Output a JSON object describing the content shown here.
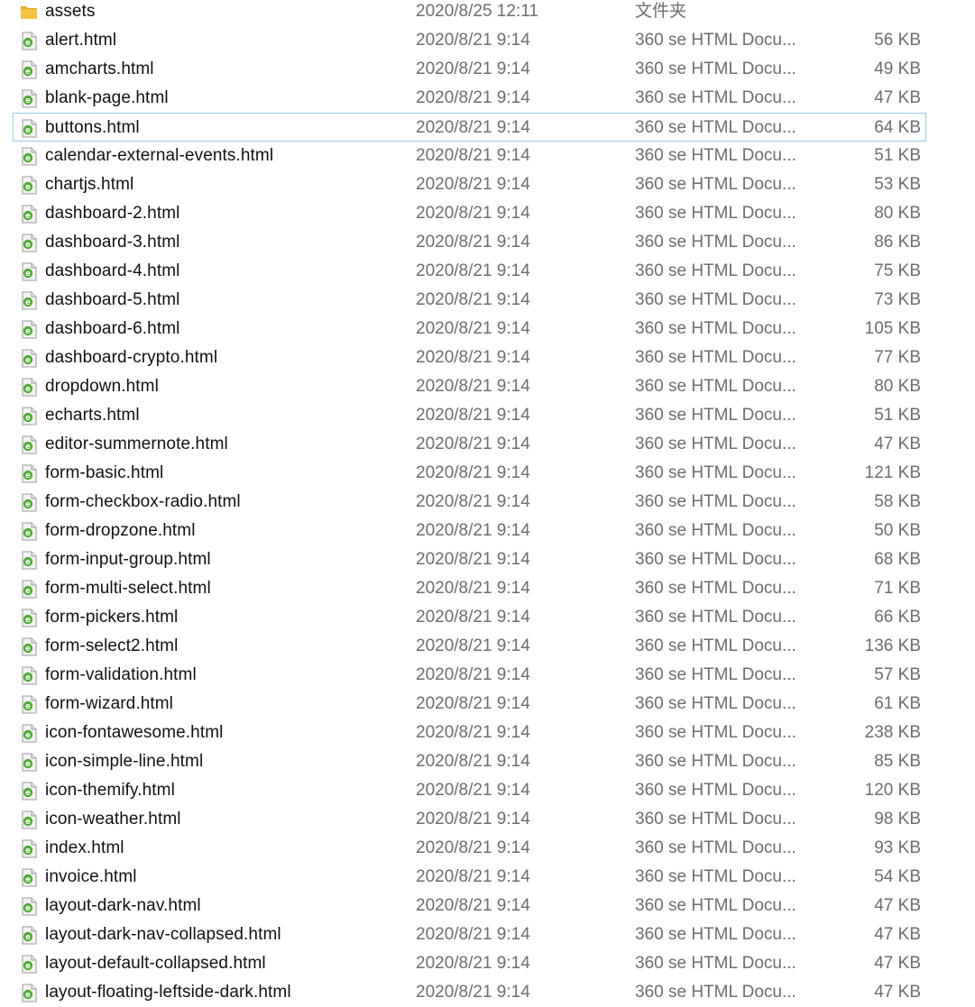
{
  "files": [
    {
      "name": "assets",
      "date": "2020/8/25 12:11",
      "type": "文件夹",
      "size": "",
      "icon": "folder-icon"
    },
    {
      "name": "alert.html",
      "date": "2020/8/21 9:14",
      "type": "360 se HTML Docu...",
      "size": "56 KB",
      "icon": "html-document-icon"
    },
    {
      "name": "amcharts.html",
      "date": "2020/8/21 9:14",
      "type": "360 se HTML Docu...",
      "size": "49 KB",
      "icon": "html-document-icon"
    },
    {
      "name": "blank-page.html",
      "date": "2020/8/21 9:14",
      "type": "360 se HTML Docu...",
      "size": "47 KB",
      "icon": "html-document-icon"
    },
    {
      "name": "buttons.html",
      "date": "2020/8/21 9:14",
      "type": "360 se HTML Docu...",
      "size": "64 KB",
      "icon": "html-document-icon",
      "selected": true
    },
    {
      "name": "calendar-external-events.html",
      "date": "2020/8/21 9:14",
      "type": "360 se HTML Docu...",
      "size": "51 KB",
      "icon": "html-document-icon"
    },
    {
      "name": "chartjs.html",
      "date": "2020/8/21 9:14",
      "type": "360 se HTML Docu...",
      "size": "53 KB",
      "icon": "html-document-icon"
    },
    {
      "name": "dashboard-2.html",
      "date": "2020/8/21 9:14",
      "type": "360 se HTML Docu...",
      "size": "80 KB",
      "icon": "html-document-icon"
    },
    {
      "name": "dashboard-3.html",
      "date": "2020/8/21 9:14",
      "type": "360 se HTML Docu...",
      "size": "86 KB",
      "icon": "html-document-icon"
    },
    {
      "name": "dashboard-4.html",
      "date": "2020/8/21 9:14",
      "type": "360 se HTML Docu...",
      "size": "75 KB",
      "icon": "html-document-icon"
    },
    {
      "name": "dashboard-5.html",
      "date": "2020/8/21 9:14",
      "type": "360 se HTML Docu...",
      "size": "73 KB",
      "icon": "html-document-icon"
    },
    {
      "name": "dashboard-6.html",
      "date": "2020/8/21 9:14",
      "type": "360 se HTML Docu...",
      "size": "105 KB",
      "icon": "html-document-icon"
    },
    {
      "name": "dashboard-crypto.html",
      "date": "2020/8/21 9:14",
      "type": "360 se HTML Docu...",
      "size": "77 KB",
      "icon": "html-document-icon"
    },
    {
      "name": "dropdown.html",
      "date": "2020/8/21 9:14",
      "type": "360 se HTML Docu...",
      "size": "80 KB",
      "icon": "html-document-icon"
    },
    {
      "name": "echarts.html",
      "date": "2020/8/21 9:14",
      "type": "360 se HTML Docu...",
      "size": "51 KB",
      "icon": "html-document-icon"
    },
    {
      "name": "editor-summernote.html",
      "date": "2020/8/21 9:14",
      "type": "360 se HTML Docu...",
      "size": "47 KB",
      "icon": "html-document-icon"
    },
    {
      "name": "form-basic.html",
      "date": "2020/8/21 9:14",
      "type": "360 se HTML Docu...",
      "size": "121 KB",
      "icon": "html-document-icon"
    },
    {
      "name": "form-checkbox-radio.html",
      "date": "2020/8/21 9:14",
      "type": "360 se HTML Docu...",
      "size": "58 KB",
      "icon": "html-document-icon"
    },
    {
      "name": "form-dropzone.html",
      "date": "2020/8/21 9:14",
      "type": "360 se HTML Docu...",
      "size": "50 KB",
      "icon": "html-document-icon"
    },
    {
      "name": "form-input-group.html",
      "date": "2020/8/21 9:14",
      "type": "360 se HTML Docu...",
      "size": "68 KB",
      "icon": "html-document-icon"
    },
    {
      "name": "form-multi-select.html",
      "date": "2020/8/21 9:14",
      "type": "360 se HTML Docu...",
      "size": "71 KB",
      "icon": "html-document-icon"
    },
    {
      "name": "form-pickers.html",
      "date": "2020/8/21 9:14",
      "type": "360 se HTML Docu...",
      "size": "66 KB",
      "icon": "html-document-icon"
    },
    {
      "name": "form-select2.html",
      "date": "2020/8/21 9:14",
      "type": "360 se HTML Docu...",
      "size": "136 KB",
      "icon": "html-document-icon"
    },
    {
      "name": "form-validation.html",
      "date": "2020/8/21 9:14",
      "type": "360 se HTML Docu...",
      "size": "57 KB",
      "icon": "html-document-icon"
    },
    {
      "name": "form-wizard.html",
      "date": "2020/8/21 9:14",
      "type": "360 se HTML Docu...",
      "size": "61 KB",
      "icon": "html-document-icon"
    },
    {
      "name": "icon-fontawesome.html",
      "date": "2020/8/21 9:14",
      "type": "360 se HTML Docu...",
      "size": "238 KB",
      "icon": "html-document-icon"
    },
    {
      "name": "icon-simple-line.html",
      "date": "2020/8/21 9:14",
      "type": "360 se HTML Docu...",
      "size": "85 KB",
      "icon": "html-document-icon"
    },
    {
      "name": "icon-themify.html",
      "date": "2020/8/21 9:14",
      "type": "360 se HTML Docu...",
      "size": "120 KB",
      "icon": "html-document-icon"
    },
    {
      "name": "icon-weather.html",
      "date": "2020/8/21 9:14",
      "type": "360 se HTML Docu...",
      "size": "98 KB",
      "icon": "html-document-icon"
    },
    {
      "name": "index.html",
      "date": "2020/8/21 9:14",
      "type": "360 se HTML Docu...",
      "size": "93 KB",
      "icon": "html-document-icon"
    },
    {
      "name": "invoice.html",
      "date": "2020/8/21 9:14",
      "type": "360 se HTML Docu...",
      "size": "54 KB",
      "icon": "html-document-icon"
    },
    {
      "name": "layout-dark-nav.html",
      "date": "2020/8/21 9:14",
      "type": "360 se HTML Docu...",
      "size": "47 KB",
      "icon": "html-document-icon"
    },
    {
      "name": "layout-dark-nav-collapsed.html",
      "date": "2020/8/21 9:14",
      "type": "360 se HTML Docu...",
      "size": "47 KB",
      "icon": "html-document-icon"
    },
    {
      "name": "layout-default-collapsed.html",
      "date": "2020/8/21 9:14",
      "type": "360 se HTML Docu...",
      "size": "47 KB",
      "icon": "html-document-icon"
    },
    {
      "name": "layout-floating-leftside-dark.html",
      "date": "2020/8/21 9:14",
      "type": "360 se HTML Docu...",
      "size": "47 KB",
      "icon": "html-document-icon"
    }
  ],
  "colors": {
    "selection_border": "#99c9ef",
    "folder": "#f5c242",
    "html_icon_accent": "#4cae2e"
  }
}
